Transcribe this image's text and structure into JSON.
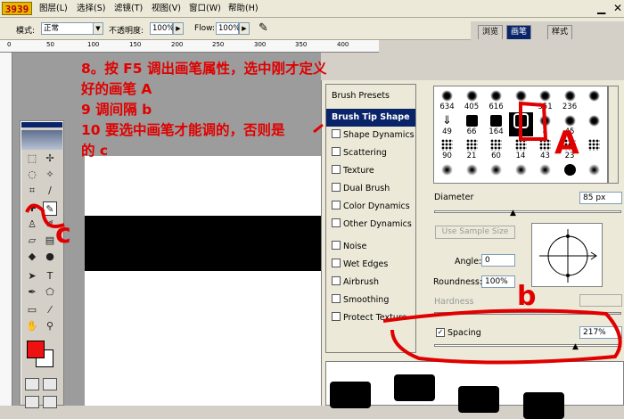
{
  "app": {
    "logo_text": "3939",
    "menu": [
      "图层(L)",
      "选择(S)",
      "滤镜(T)",
      "视图(V)",
      "窗口(W)",
      "帮助(H)"
    ]
  },
  "options_bar": {
    "mode_label": "模式:",
    "mode_value": "正常",
    "opacity_label": "不透明度:",
    "opacity_value": "100%",
    "flow_label": "Flow:",
    "flow_value": "100%"
  },
  "panel_tabs": [
    "浏览",
    "画笔",
    "样式"
  ],
  "ruler_numbers": [
    "0",
    "50",
    "100",
    "150",
    "200",
    "250",
    "300",
    "350",
    "400"
  ],
  "instructions": {
    "line1": "8。按 F5 调出画笔属性，选中刚才定义",
    "line2": "好的画笔 A",
    "line3": "9 调间隔 b",
    "line4": "10 要选中画笔才能调的，否则是",
    "line5": "的 c"
  },
  "brush_panel": {
    "items": [
      {
        "label": "Brush Presets",
        "checkbox": false,
        "active": false
      },
      {
        "label": "Brush Tip Shape",
        "checkbox": false,
        "active": true
      },
      {
        "label": "Shape Dynamics",
        "checkbox": true,
        "active": false
      },
      {
        "label": "Scattering",
        "checkbox": true,
        "active": false
      },
      {
        "label": "Texture",
        "checkbox": true,
        "active": false
      },
      {
        "label": "Dual Brush",
        "checkbox": true,
        "active": false
      },
      {
        "label": "Color Dynamics",
        "checkbox": true,
        "active": false
      },
      {
        "label": "Other Dynamics",
        "checkbox": true,
        "active": false
      },
      {
        "label": "Noise",
        "checkbox": true,
        "active": false
      },
      {
        "label": "Wet Edges",
        "checkbox": true,
        "active": false
      },
      {
        "label": "Airbrush",
        "checkbox": true,
        "active": false
      },
      {
        "label": "Smoothing",
        "checkbox": true,
        "active": false
      },
      {
        "label": "Protect Texture",
        "checkbox": true,
        "active": false
      }
    ],
    "tips": [
      {
        "num": "634",
        "kind": "splat"
      },
      {
        "num": "405",
        "kind": "splat"
      },
      {
        "num": "616",
        "kind": "splat"
      },
      {
        "num": "",
        "kind": "splat"
      },
      {
        "num": "351",
        "kind": "splat"
      },
      {
        "num": "236",
        "kind": "splat"
      },
      {
        "num": "",
        "kind": "splat"
      },
      {
        "num": "49",
        "kind": "arrow"
      },
      {
        "num": "66",
        "kind": "square"
      },
      {
        "num": "164",
        "kind": "square"
      },
      {
        "num": "",
        "kind": "selected"
      },
      {
        "num": "4",
        "kind": "splat"
      },
      {
        "num": "45",
        "kind": "splat"
      },
      {
        "num": "",
        "kind": "splat"
      },
      {
        "num": "90",
        "kind": "dots"
      },
      {
        "num": "21",
        "kind": "dots"
      },
      {
        "num": "60",
        "kind": "dots"
      },
      {
        "num": "14",
        "kind": "dots"
      },
      {
        "num": "43",
        "kind": "dots"
      },
      {
        "num": "23",
        "kind": "dots"
      },
      {
        "num": "",
        "kind": "dots"
      },
      {
        "num": "",
        "kind": "soft"
      },
      {
        "num": "",
        "kind": "soft"
      },
      {
        "num": "",
        "kind": "soft"
      },
      {
        "num": "",
        "kind": "soft"
      },
      {
        "num": "",
        "kind": "soft"
      },
      {
        "num": "",
        "kind": "round"
      },
      {
        "num": "",
        "kind": "soft"
      }
    ],
    "diameter_label": "Diameter",
    "diameter_value": "85 px",
    "use_sample_label": "Use Sample Size",
    "angle_label": "Angle:",
    "angle_value": "0",
    "roundness_label": "Roundness:",
    "roundness_value": "100%",
    "hardness_label": "Hardness",
    "spacing_label": "Spacing",
    "spacing_value": "217%",
    "spacing_checked": true
  },
  "annotations": {
    "a": "A",
    "b": "b",
    "c": "c"
  },
  "colors": {
    "foreground": "#ee1111",
    "background": "#ffffff",
    "annotation_red": "#e00000",
    "selection_blue": "#0a246a"
  }
}
